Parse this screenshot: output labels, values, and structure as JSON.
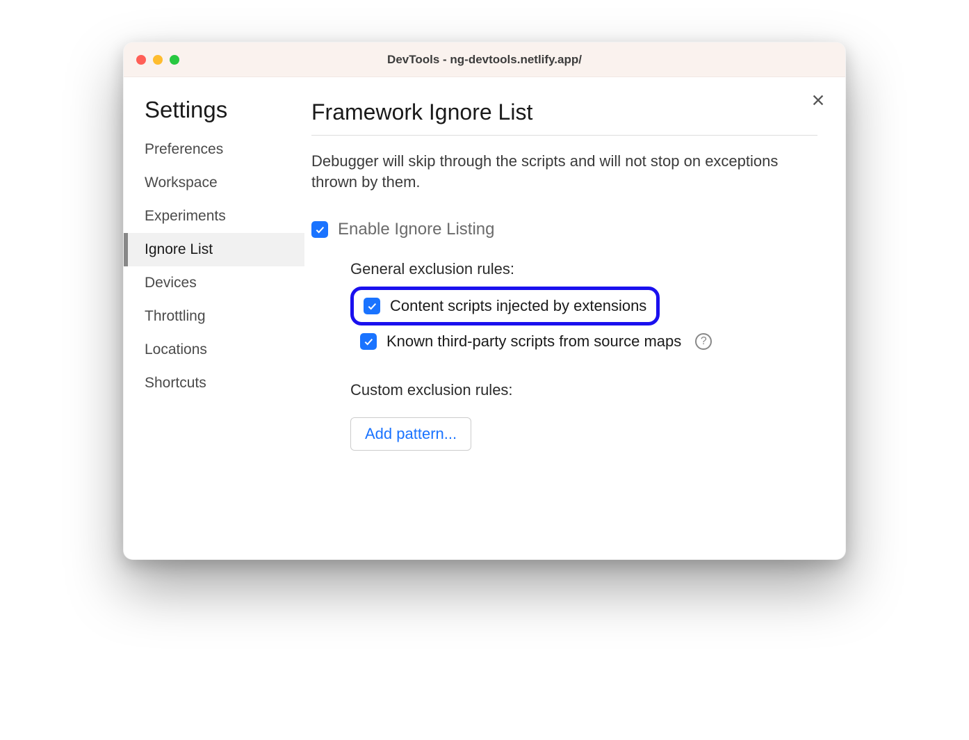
{
  "window": {
    "title": "DevTools - ng-devtools.netlify.app/"
  },
  "sidebar": {
    "heading": "Settings",
    "items": [
      {
        "label": "Preferences",
        "active": false
      },
      {
        "label": "Workspace",
        "active": false
      },
      {
        "label": "Experiments",
        "active": false
      },
      {
        "label": "Ignore List",
        "active": true
      },
      {
        "label": "Devices",
        "active": false
      },
      {
        "label": "Throttling",
        "active": false
      },
      {
        "label": "Locations",
        "active": false
      },
      {
        "label": "Shortcuts",
        "active": false
      }
    ]
  },
  "main": {
    "title": "Framework Ignore List",
    "description": "Debugger will skip through the scripts and will not stop on exceptions thrown by them.",
    "enable_label": "Enable Ignore Listing",
    "enable_checked": true,
    "general_heading": "General exclusion rules:",
    "rules": [
      {
        "label": "Content scripts injected by extensions",
        "checked": true,
        "highlighted": true,
        "help": false
      },
      {
        "label": "Known third-party scripts from source maps",
        "checked": true,
        "highlighted": false,
        "help": true
      }
    ],
    "custom_heading": "Custom exclusion rules:",
    "add_pattern_label": "Add pattern..."
  },
  "colors": {
    "checkbox_blue": "#1a73ff",
    "highlight_border": "#1a10ee"
  }
}
